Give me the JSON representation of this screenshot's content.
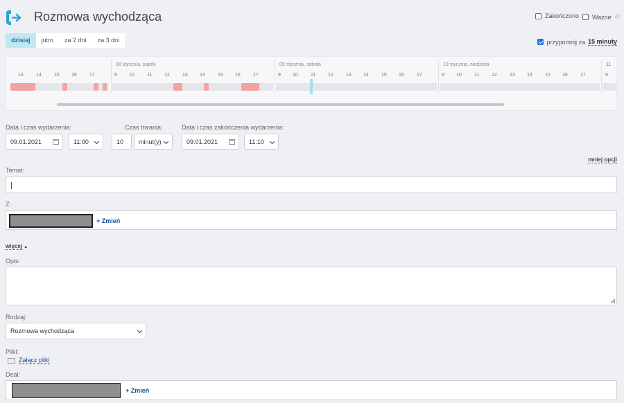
{
  "header": {
    "title": "Rozmowa wychodząca",
    "completed_label": "Zakończono",
    "important_label": "Ważne"
  },
  "day_tabs": [
    {
      "label": "dzisiaj",
      "active": true
    },
    {
      "label": "jutro",
      "active": false
    },
    {
      "label": "za 2 dni",
      "active": false
    },
    {
      "label": "za 3 dni",
      "active": false
    }
  ],
  "reminder": {
    "checked": true,
    "label": "przypomnij za",
    "value": "15 minuty"
  },
  "timeline": {
    "days": [
      "08 stycznia, piątek",
      "09 stycznia, sobota",
      "10 stycznia, niedziela"
    ],
    "hours_pre": [
      "13",
      "14",
      "15",
      "16",
      "17"
    ],
    "hours_day1": [
      "9",
      "10",
      "11",
      "12",
      "13",
      "14",
      "15",
      "16",
      "17"
    ],
    "hours_day2": [
      "9",
      "10",
      "11",
      "12",
      "13",
      "14",
      "15",
      "16",
      "17"
    ],
    "hours_day3": [
      "9",
      "10",
      "11",
      "12",
      "13",
      "14",
      "15",
      "16",
      "17"
    ],
    "hours_post": [
      "11",
      "9"
    ]
  },
  "form": {
    "start_label": "Data i czas wydarzenia:",
    "start_date": "09.01.2021",
    "start_time": "11:00",
    "duration_label": "Czas trwania:",
    "duration_value": "10",
    "duration_unit": "minut(y)",
    "end_label": "Data i czas zakończenia wydarzenia:",
    "end_date": "09.01.2021",
    "end_time": "11:10",
    "less_options": "mniej opcji",
    "subject_label": "Temat:",
    "from_label": "Z:",
    "change_label": "+ Zmień",
    "more_label": "więcej",
    "description_label": "Opis:",
    "type_label": "Rodzaj:",
    "type_value": "Rozmowa wychodząca",
    "files_label": "Pliki:",
    "attach_label": "Załącz pliki",
    "deal_label": "Deal:",
    "deal_change_label": "+ Zmień"
  },
  "colors": {
    "accent": "#29a6d9",
    "busy": "#f4a3a3",
    "link": "#1a4b8c"
  }
}
